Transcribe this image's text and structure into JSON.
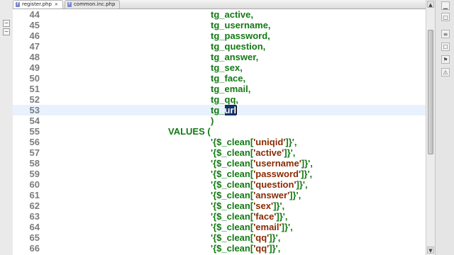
{
  "tabs": [
    {
      "label": "register.php",
      "icon": "php-file-icon",
      "active": true,
      "close": "✕"
    },
    {
      "label": "common.inc.php",
      "icon": "php-file-icon",
      "active": false
    }
  ],
  "editor": {
    "lines": [
      {
        "num": "44",
        "indent": 1,
        "parts": [
          {
            "t": "tg_active,",
            "c": "plain"
          }
        ]
      },
      {
        "num": "45",
        "indent": 1,
        "parts": [
          {
            "t": "tg_username,",
            "c": "plain"
          }
        ]
      },
      {
        "num": "46",
        "indent": 1,
        "parts": [
          {
            "t": "tg_password,",
            "c": "plain"
          }
        ]
      },
      {
        "num": "47",
        "indent": 1,
        "parts": [
          {
            "t": "tg_question,",
            "c": "plain"
          }
        ]
      },
      {
        "num": "48",
        "indent": 1,
        "parts": [
          {
            "t": "tg_answer,",
            "c": "plain"
          }
        ]
      },
      {
        "num": "49",
        "indent": 1,
        "parts": [
          {
            "t": "tg_sex,",
            "c": "plain"
          }
        ]
      },
      {
        "num": "50",
        "indent": 1,
        "parts": [
          {
            "t": "tg_face,",
            "c": "plain"
          }
        ]
      },
      {
        "num": "51",
        "indent": 1,
        "parts": [
          {
            "t": "tg_email,",
            "c": "plain"
          }
        ]
      },
      {
        "num": "52",
        "indent": 1,
        "parts": [
          {
            "t": "tg_qq,",
            "c": "plain"
          }
        ]
      },
      {
        "num": "53",
        "indent": 1,
        "current": true,
        "parts": [
          {
            "t": "tg_",
            "c": "plain"
          },
          {
            "t": "url",
            "c": "sel"
          }
        ]
      },
      {
        "num": "54",
        "indent": 1,
        "parts": [
          {
            "t": ")",
            "c": "plain"
          }
        ]
      },
      {
        "num": "55",
        "indent": 0,
        "parts": [
          {
            "t": "VALUES (",
            "c": "plain"
          }
        ]
      },
      {
        "num": "56",
        "indent": 1,
        "parts": [
          {
            "t": "'{$_clean[",
            "c": "plain"
          },
          {
            "t": "'uniqid'",
            "c": "str"
          },
          {
            "t": "]}',",
            "c": "plain"
          }
        ]
      },
      {
        "num": "57",
        "indent": 1,
        "parts": [
          {
            "t": "'{$_clean[",
            "c": "plain"
          },
          {
            "t": "'active'",
            "c": "str"
          },
          {
            "t": "]}',",
            "c": "plain"
          }
        ]
      },
      {
        "num": "58",
        "indent": 1,
        "parts": [
          {
            "t": "'{$_clean[",
            "c": "plain"
          },
          {
            "t": "'username'",
            "c": "str"
          },
          {
            "t": "]}',",
            "c": "plain"
          }
        ]
      },
      {
        "num": "59",
        "indent": 1,
        "parts": [
          {
            "t": "'{$_clean[",
            "c": "plain"
          },
          {
            "t": "'password'",
            "c": "str"
          },
          {
            "t": "]}',",
            "c": "plain"
          }
        ]
      },
      {
        "num": "60",
        "indent": 1,
        "parts": [
          {
            "t": "'{$_clean[",
            "c": "plain"
          },
          {
            "t": "'question'",
            "c": "str"
          },
          {
            "t": "]}',",
            "c": "plain"
          }
        ]
      },
      {
        "num": "61",
        "indent": 1,
        "parts": [
          {
            "t": "'{$_clean[",
            "c": "plain"
          },
          {
            "t": "'answer'",
            "c": "str"
          },
          {
            "t": "]}',",
            "c": "plain"
          }
        ]
      },
      {
        "num": "62",
        "indent": 1,
        "parts": [
          {
            "t": "'{$_clean[",
            "c": "plain"
          },
          {
            "t": "'sex'",
            "c": "str"
          },
          {
            "t": "]}',",
            "c": "plain"
          }
        ]
      },
      {
        "num": "63",
        "indent": 1,
        "parts": [
          {
            "t": "'{$_clean[",
            "c": "plain"
          },
          {
            "t": "'face'",
            "c": "str"
          },
          {
            "t": "]}',",
            "c": "plain"
          }
        ]
      },
      {
        "num": "64",
        "indent": 1,
        "parts": [
          {
            "t": "'{$_clean[",
            "c": "plain"
          },
          {
            "t": "'email'",
            "c": "str"
          },
          {
            "t": "]}',",
            "c": "plain"
          }
        ]
      },
      {
        "num": "65",
        "indent": 1,
        "parts": [
          {
            "t": "'{$_clean[",
            "c": "plain"
          },
          {
            "t": "'qq'",
            "c": "str"
          },
          {
            "t": "]}',",
            "c": "plain"
          }
        ]
      },
      {
        "num": "66",
        "indent": 1,
        "parts": [
          {
            "t": "'{$_clean[",
            "c": "plain"
          },
          {
            "t": "'qq'",
            "c": "str"
          },
          {
            "t": "]}',",
            "c": "plain"
          }
        ]
      }
    ]
  },
  "colors": {
    "code": "#127a12",
    "string": "#8a2a00",
    "line_number": "#7c7c7c",
    "selection_bg": "#14306a",
    "current_line_bg": "#e8f2fe"
  },
  "right_toolbar": {
    "icons": [
      "minimize-icon",
      "maximize-icon",
      "outline-icon",
      "tasks-icon",
      "bookmarks-icon",
      "problems-icon"
    ]
  },
  "scrollbar": {
    "up_icon": "▲",
    "down_icon": "▼"
  }
}
